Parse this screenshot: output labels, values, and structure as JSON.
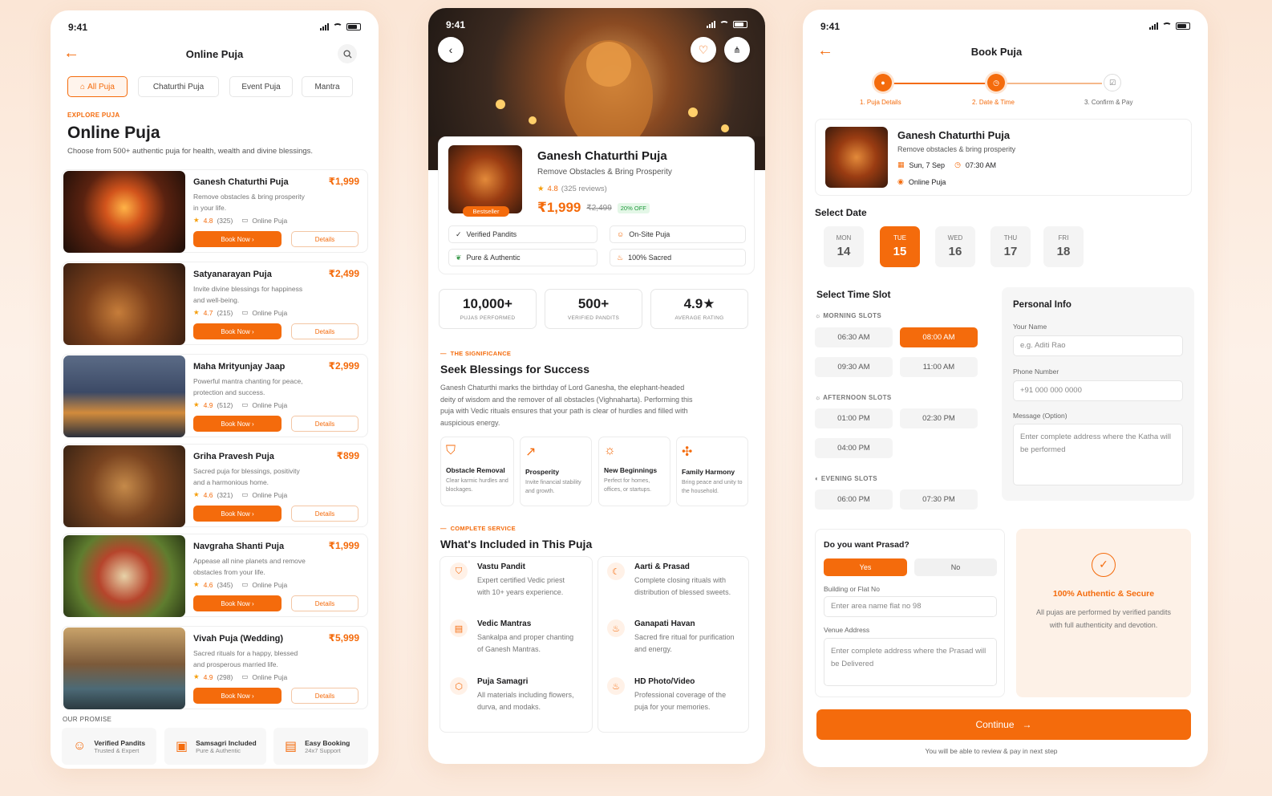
{
  "status_time": "9:41",
  "p1": {
    "title": "Online Puja",
    "tabs": [
      "All Puja",
      "Chaturthi Puja",
      "Event Puja",
      "Mantra"
    ],
    "explore": "EXPLORE PUJA",
    "heading": "Online Puja",
    "subtitle": "Choose from 500+ authentic puja for health, wealth and divine blessings.",
    "book_label": "Book Now",
    "details_label": "Details",
    "online_label": "Online Puja",
    "pujas": [
      {
        "name": "Ganesh Chaturthi Puja",
        "price": "₹1,999",
        "desc1": "Remove obstacles & bring prosperity",
        "desc2": "in your life.",
        "rating": "4.8",
        "reviews": "(325)"
      },
      {
        "name": "Satyanarayan Puja",
        "price": "₹2,499",
        "desc1": "Invite divine blessings for happiness",
        "desc2": "and well-being.",
        "rating": "4.7",
        "reviews": "(215)"
      },
      {
        "name": "Maha Mrityunjay Jaap",
        "price": "₹2,999",
        "desc1": "Powerful mantra chanting for peace,",
        "desc2": "protection and success.",
        "rating": "4.9",
        "reviews": "(512)"
      },
      {
        "name": "Griha Pravesh Puja",
        "price": "₹899",
        "desc1": "Sacred puja for blessings, positivity",
        "desc2": "and a harmonious home.",
        "rating": "4.6",
        "reviews": "(321)"
      },
      {
        "name": "Navgraha Shanti Puja",
        "price": "₹1,999",
        "desc1": "Appease all nine planets and remove",
        "desc2": "obstacles from your life.",
        "rating": "4.6",
        "reviews": "(345)"
      },
      {
        "name": "Vivah Puja (Wedding)",
        "price": "₹5,999",
        "desc1": "Sacred rituals for a happy, blessed",
        "desc2": "and prosperous married life.",
        "rating": "4.9",
        "reviews": "(298)"
      }
    ],
    "promise_title": "OUR PROMISE",
    "promise": [
      {
        "t1": "Verified Pandits",
        "t2": "Trusted & Expert"
      },
      {
        "t1": "Samsagri Included",
        "t2": "Pure & Authentic"
      },
      {
        "t1": "Easy Booking",
        "t2": "24x7 Support"
      }
    ]
  },
  "p2": {
    "name": "Ganesh Chaturthi Puja",
    "tagline": "Remove Obstacles & Bring Prosperity",
    "rating": "4.8",
    "reviews": "(325 reviews)",
    "price": "₹1,999",
    "old_price": "₹2,499",
    "off": "20% OFF",
    "badge": "Bestseller",
    "tags": [
      "Verified Pandits",
      "On-Site Puja",
      "Pure & Authentic",
      "100% Sacred"
    ],
    "stats": [
      {
        "v": "10,000+",
        "l": "PUJAS PERFORMED"
      },
      {
        "v": "500+",
        "l": "VERIFIED PANDITS"
      },
      {
        "v": "4.9★",
        "l": "AVERAGE RATING"
      }
    ],
    "sig_tag": "THE SIGNIFICANCE",
    "sig_h": "Seek Blessings for Success",
    "sig_body": "Ganesh Chaturthi marks the birthday of Lord Ganesha, the elephant-headed deity of wisdom and the remover of all obstacles (Vighnaharta). Performing this puja with Vedic rituals ensures that your path is clear of hurdles and filled with auspicious energy.",
    "benefits": [
      {
        "t": "Obstacle Removal",
        "d": "Clear karmic hurdles and blockages."
      },
      {
        "t": "Prosperity",
        "d": "Invite financial stability and growth."
      },
      {
        "t": "New Beginnings",
        "d": "Perfect for homes, offices, or startups."
      },
      {
        "t": "Family Harmony",
        "d": "Bring peace and unity to the household."
      }
    ],
    "svc_tag": "COMPLETE SERVICE",
    "svc_h": "What's Included in This Puja",
    "included": [
      {
        "t": "Vastu Pandit",
        "d": "Expert certified Vedic priest with 10+ years experience."
      },
      {
        "t": "Aarti & Prasad",
        "d": "Complete closing rituals with distribution of blessed sweets."
      },
      {
        "t": "Vedic Mantras",
        "d": "Sankalpa and proper chanting of Ganesh Mantras."
      },
      {
        "t": "Ganapati Havan",
        "d": "Sacred fire ritual for purification and energy."
      },
      {
        "t": "Puja Samagri",
        "d": "All materials including flowers, durva, and modaks."
      },
      {
        "t": "HD Photo/Video",
        "d": "Professional coverage of the puja for your memories."
      }
    ]
  },
  "p3": {
    "title": "Book Puja",
    "steps": [
      "1. Puja Details",
      "2. Date & Time",
      "3. Confirm & Pay"
    ],
    "summary": {
      "name": "Ganesh Chaturthi Puja",
      "tagline": "Remove obstacles & bring prosperity",
      "date": "Sun, 7 Sep",
      "time": "07:30 AM",
      "mode": "Online Puja"
    },
    "select_date": "Select Date",
    "dates": [
      {
        "d": "MON",
        "n": "14"
      },
      {
        "d": "TUE",
        "n": "15"
      },
      {
        "d": "WED",
        "n": "16"
      },
      {
        "d": "THU",
        "n": "17"
      },
      {
        "d": "FRI",
        "n": "18"
      }
    ],
    "select_time": "Select Time Slot",
    "morning": "MORNING SLOTS",
    "afternoon": "AFTERNOON SLOTS",
    "evening": "EVENING SLOTS",
    "slots_m": [
      "06:30 AM",
      "08:00 AM",
      "09:30 AM",
      "11:00 AM"
    ],
    "slots_a": [
      "01:00 PM",
      "02:30 PM",
      "04:00 PM"
    ],
    "slots_e": [
      "06:00 PM",
      "07:30 PM"
    ],
    "personal": "Personal Info",
    "name_label": "Your Name",
    "name_ph": "e.g. Aditi Rao",
    "phone_label": "Phone Number",
    "phone_ph": "+91 000 000 0000",
    "msg_label": "Message (Option)",
    "msg_ph": "Enter complete address where the Katha will be performed",
    "prasad_q": "Do you want Prasad?",
    "yes": "Yes",
    "no": "No",
    "building_label": "Building or Flat No",
    "building_ph": "Enter area name flat no 98",
    "venue_label": "Venue Address",
    "venue_ph": "Enter complete address where the Prasad will be Delivered",
    "secure_h": "100% Authentic & Secure",
    "secure_d": "All pujas are performed by verified pandits with full authenticity and devotion.",
    "continue": "Continue",
    "note": "You will be able to review & pay in next step"
  },
  "colors": {
    "accent": "#f46b0c"
  }
}
